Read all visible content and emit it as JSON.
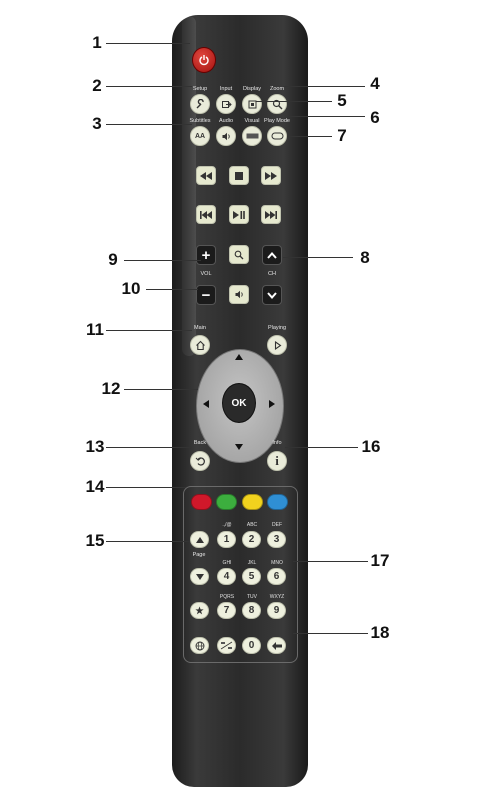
{
  "callouts": [
    "1",
    "2",
    "3",
    "4",
    "5",
    "6",
    "7",
    "8",
    "9",
    "10",
    "11",
    "12",
    "13",
    "14",
    "15",
    "16",
    "17",
    "18"
  ],
  "labels": {
    "setup": "Setup",
    "input": "Input",
    "display": "Display",
    "zoom": "Zoom",
    "subtitles": "Subtitles",
    "audio": "Audio",
    "visual": "Visual",
    "play_mode": "Play Mode",
    "vol": "VOL",
    "ch": "CH",
    "main": "Main",
    "playing": "Playing",
    "back": "Back",
    "info": "Info",
    "page": "Page"
  },
  "buttons": {
    "ok": "OK",
    "subtitles_glyph": "AA",
    "info_glyph": "i",
    "plus": "+",
    "minus": "−"
  },
  "keypad": {
    "digits": [
      "1",
      "2",
      "3",
      "4",
      "5",
      "6",
      "7",
      "8",
      "9",
      "0"
    ],
    "letters": [
      ".,/@",
      "ABC",
      "DEF",
      "GHI",
      "JKL",
      "MNO",
      "PQRS",
      "TUV",
      "WXYZ"
    ]
  },
  "colors": {
    "red": "#d0182a",
    "green": "#3cae3e",
    "yellow": "#f1d21e",
    "blue": "#2f8fd4",
    "power": "#c22a22"
  },
  "icons": [
    "power-icon",
    "wrench-icon",
    "input-icon",
    "display-icon",
    "zoom-icon",
    "subtitles-icon",
    "speaker-icon",
    "visual-icon",
    "playmode-icon",
    "rewind-icon",
    "stop-icon",
    "fast-forward-icon",
    "skip-back-icon",
    "play-pause-icon",
    "skip-forward-icon",
    "search-icon",
    "home-icon",
    "play-circle-icon",
    "back-icon",
    "info-icon",
    "globe-icon",
    "backspace-icon",
    "star-icon"
  ]
}
